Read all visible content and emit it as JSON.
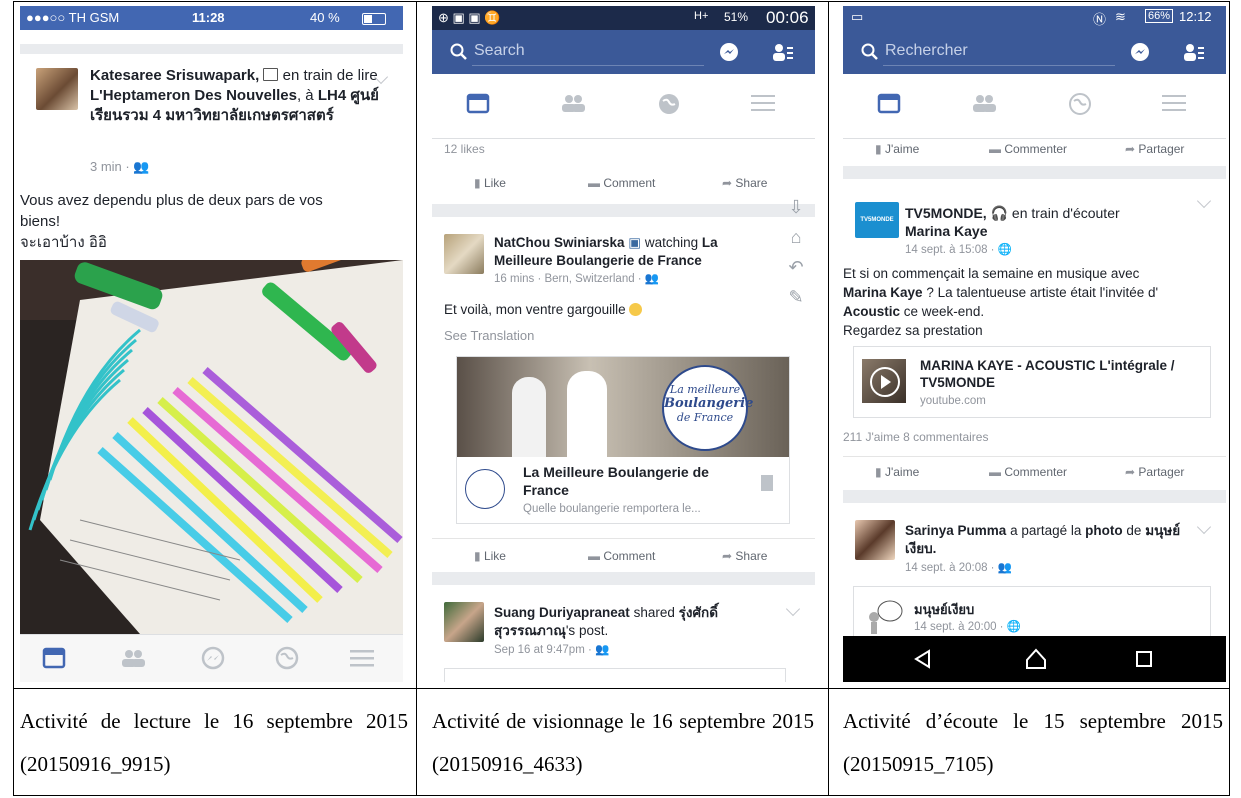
{
  "captions": [
    "Activité de lecture le 16 septembre 2015 (20150916_9915)",
    "Activité de visionnage le 16 septembre 2015 (20150916_4633)",
    "Activité d’écoute le 15 septembre 2015 (20150915_7105)"
  ],
  "screen1": {
    "status": {
      "carrier": "●●●○○ TH GSM",
      "time": "11:28",
      "battery": "40 %"
    },
    "post": {
      "author": "Katesaree Srisuwapark,",
      "activity": "en train de lire",
      "book": "L'Heptameron Des Nouvelles",
      "at": ", à",
      "place": "LH4 ศูนย์เรียนรวม 4 มหาวิทยาลัยเกษตรศาสตร์",
      "time": "3 min ·",
      "text_line1": "Vous avez dependu plus de deux pars de vos",
      "text_line2": "biens!",
      "text_line3": "จะเอาบ้าง อิอิ"
    },
    "tabbar": [
      "news-feed-icon",
      "friends-icon",
      "messenger-icon",
      "globe-icon",
      "menu-icon"
    ]
  },
  "screen2": {
    "status": {
      "network": "H+",
      "battery": "51%",
      "time": "00:06"
    },
    "search_placeholder": "Search",
    "likes_count": "12 likes",
    "actions": {
      "like": "Like",
      "comment": "Comment",
      "share": "Share"
    },
    "post": {
      "author": "NatChou Swiniarska",
      "activity": "watching",
      "title": "La Meilleure Boulangerie de France",
      "meta": "16 mins · Bern, Switzerland ·",
      "text": "Et voilà, mon ventre gargouille",
      "see_translation": "See Translation",
      "badge_line1": "La meilleure",
      "badge_line2": "Boulangerie",
      "badge_line3": "de France",
      "card_title": "La Meilleure Boulangerie de France",
      "card_subtitle": "Quelle boulangerie remportera le..."
    },
    "post2": {
      "author": "Suang Duriyapraneat",
      "shared": "shared",
      "shared_from": "รุ่งศักดิ์ สุวรรณภาณุ",
      "suffix": "'s post.",
      "meta": "Sep 16 at 9:47pm ·"
    }
  },
  "screen3": {
    "status": {
      "battery": "66%",
      "time": "12:12"
    },
    "search_placeholder": "Rechercher",
    "actions": {
      "like": "J'aime",
      "comment": "Commenter",
      "share": "Partager"
    },
    "post": {
      "author": "TV5MONDE,",
      "activity": "en train d'écouter",
      "artist": "Marina Kaye",
      "meta": "14 sept. à 15:08 ·",
      "text1": "Et si on commençait la semaine en musique avec",
      "text2_bold": "Marina Kaye",
      "text2": "? La talentueuse artiste était l'invitée d'",
      "text3_bold": "Acoustic",
      "text3": "ce week-end.",
      "text4": "Regardez sa prestation",
      "logo": "TV5MONDE",
      "card_title": "MARINA KAYE - ACOUSTIC L'intégrale / TV5MONDE",
      "card_domain": "youtube.com",
      "stats": "211 J'aime  8 commentaires"
    },
    "post2": {
      "author": "Sarinya Pumma",
      "shared": "a partagé la",
      "photo": "photo",
      "de": "de",
      "from": "มนุษย์เงียบ.",
      "meta": "14 sept. à 20:08 ·",
      "inner_author": "มนุษย์เงียบ",
      "inner_meta": "14 sept. à 20:00 ·"
    }
  }
}
